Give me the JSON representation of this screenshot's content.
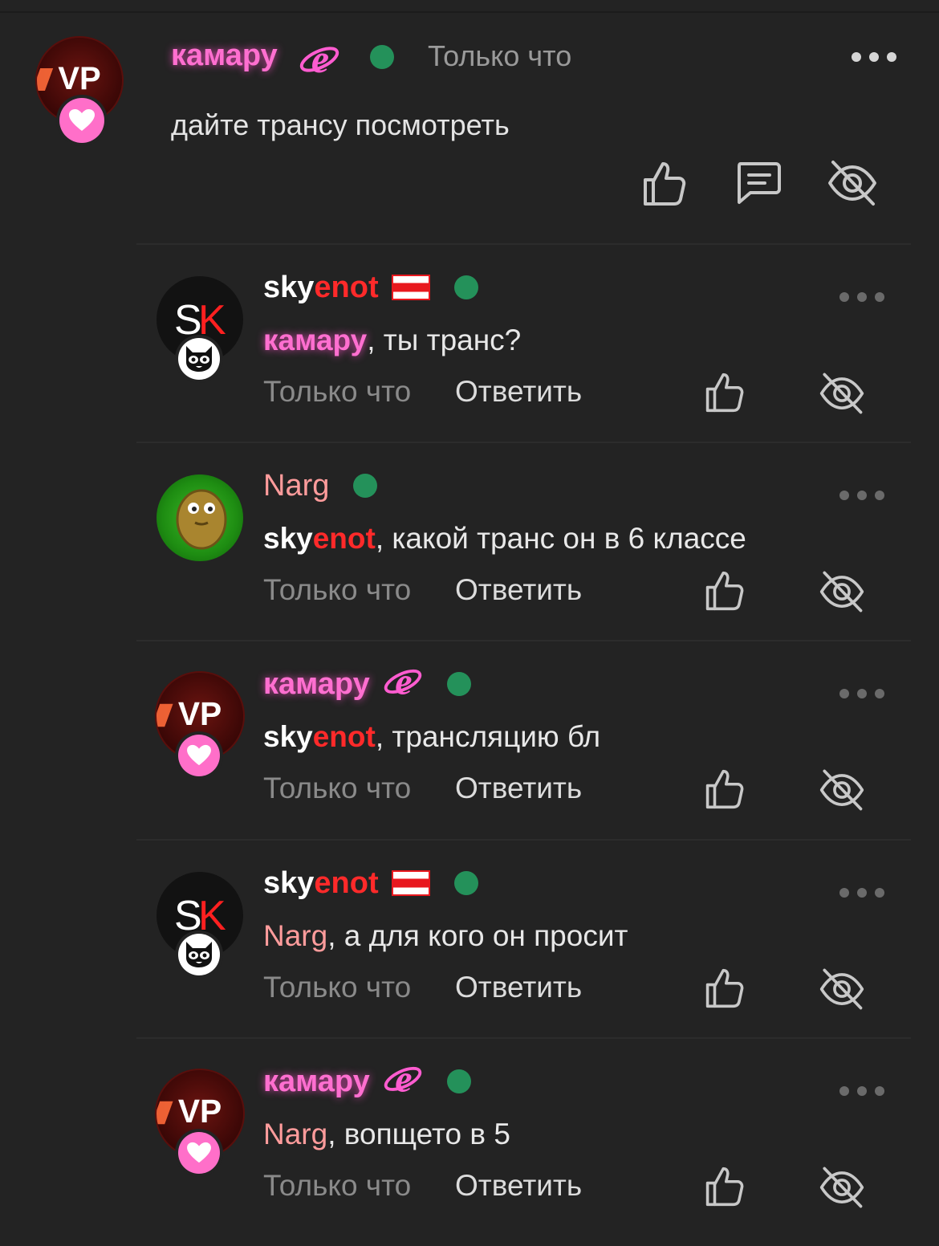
{
  "root": {
    "username": "камару",
    "status": "online",
    "time": "Только что",
    "text": "дайте трансу посмотреть",
    "avatar": {
      "initials": "VP"
    },
    "badge": "heart-icon",
    "flair": "ie-logo-icon"
  },
  "replies": [
    {
      "user_a": "sky",
      "user_b": "enot",
      "user_style": "skyenot",
      "flair": "belarus-flag-icon",
      "avatar": {
        "initials_a": "S",
        "initials_b": "K"
      },
      "badge": "raccoon-icon",
      "mention": "камару",
      "mention_style": "kam",
      "text": ", ты транс?",
      "time": "Только что",
      "reply_label": "Ответить"
    },
    {
      "user_a": "Narg",
      "user_b": "",
      "user_style": "narg",
      "flair": "",
      "avatar": {
        "type": "wallnut"
      },
      "badge": "",
      "mention_a": "sky",
      "mention_b": "enot",
      "mention_style": "sky",
      "text": ", какой транс он в 6 классе",
      "time": "Только что",
      "reply_label": "Ответить"
    },
    {
      "user_a": "камару",
      "user_b": "",
      "user_style": "kam",
      "flair": "ie-logo-icon",
      "avatar": {
        "initials": "VP"
      },
      "badge": "heart-icon",
      "mention_a": "sky",
      "mention_b": "enot",
      "mention_style": "sky",
      "text": ", трансляцию бл",
      "time": "Только что",
      "reply_label": "Ответить"
    },
    {
      "user_a": "sky",
      "user_b": "enot",
      "user_style": "skyenot",
      "flair": "belarus-flag-icon",
      "avatar": {
        "initials_a": "S",
        "initials_b": "K"
      },
      "badge": "raccoon-icon",
      "mention": "Narg",
      "mention_style": "narg",
      "text": ", а для кого он просит",
      "time": "Только что",
      "reply_label": "Ответить"
    },
    {
      "user_a": "камару",
      "user_b": "",
      "user_style": "kam",
      "flair": "ie-logo-icon",
      "avatar": {
        "initials": "VP"
      },
      "badge": "heart-icon",
      "mention": "Narg",
      "mention_style": "narg",
      "text": ", вопщето в 5",
      "time": "Только что",
      "reply_label": "Ответить"
    }
  ],
  "colors": {
    "background": "#232323",
    "online": "#24915a",
    "kamapy_name": "#ff6fd0",
    "enot_red": "#ff2a2a",
    "narg_name": "#ff9c9c"
  }
}
